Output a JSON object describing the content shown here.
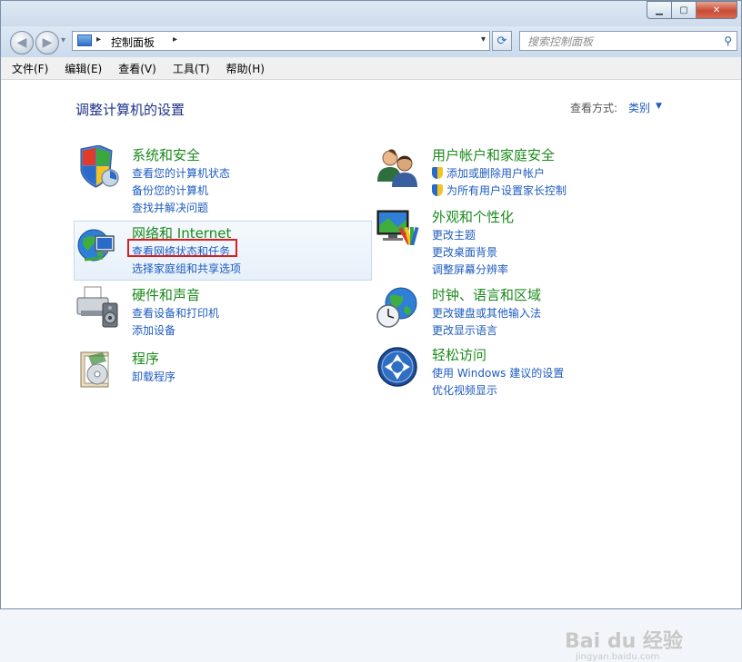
{
  "window": {
    "caption_min": "▁",
    "caption_max": "▢",
    "caption_close": "✕"
  },
  "nav": {
    "back_glyph": "◀",
    "forward_glyph": "▶",
    "history_glyph": "▾",
    "breadcrumb_sep": "▸",
    "breadcrumb": "控制面板",
    "address_dropdown_glyph": "▾",
    "refresh_glyph": "⟳",
    "search_placeholder": "搜索控制面板",
    "search_icon_glyph": "⚲"
  },
  "menu": [
    "文件(F)",
    "编辑(E)",
    "查看(V)",
    "工具(T)",
    "帮助(H)"
  ],
  "main": {
    "title": "调整计算机的设置",
    "view_by_label": "查看方式:",
    "view_by_value": "类别",
    "view_by_arrow": "▼"
  },
  "categories": [
    {
      "title": "系统和安全",
      "links": [
        "查看您的计算机状态",
        "备份您的计算机",
        "查找并解决问题"
      ]
    },
    {
      "title": "网络和 Internet",
      "links": [
        "查看网络状态和任务",
        "选择家庭组和共享选项"
      ]
    },
    {
      "title": "硬件和声音",
      "links": [
        "查看设备和打印机",
        "添加设备"
      ]
    },
    {
      "title": "程序",
      "links": [
        "卸载程序"
      ]
    },
    {
      "title": "用户帐户和家庭安全",
      "links": [
        "添加或删除用户帐户",
        "为所有用户设置家长控制"
      ]
    },
    {
      "title": "外观和个性化",
      "links": [
        "更改主题",
        "更改桌面背景",
        "调整屏幕分辨率"
      ]
    },
    {
      "title": "时钟、语言和区域",
      "links": [
        "更改键盘或其他输入法",
        "更改显示语言"
      ]
    },
    {
      "title": "轻松访问",
      "links": [
        "使用 Windows 建议的设置",
        "优化视频显示"
      ]
    }
  ],
  "watermark": {
    "main": "Bai du 经验",
    "sub": "jingyan.baidu.com"
  }
}
